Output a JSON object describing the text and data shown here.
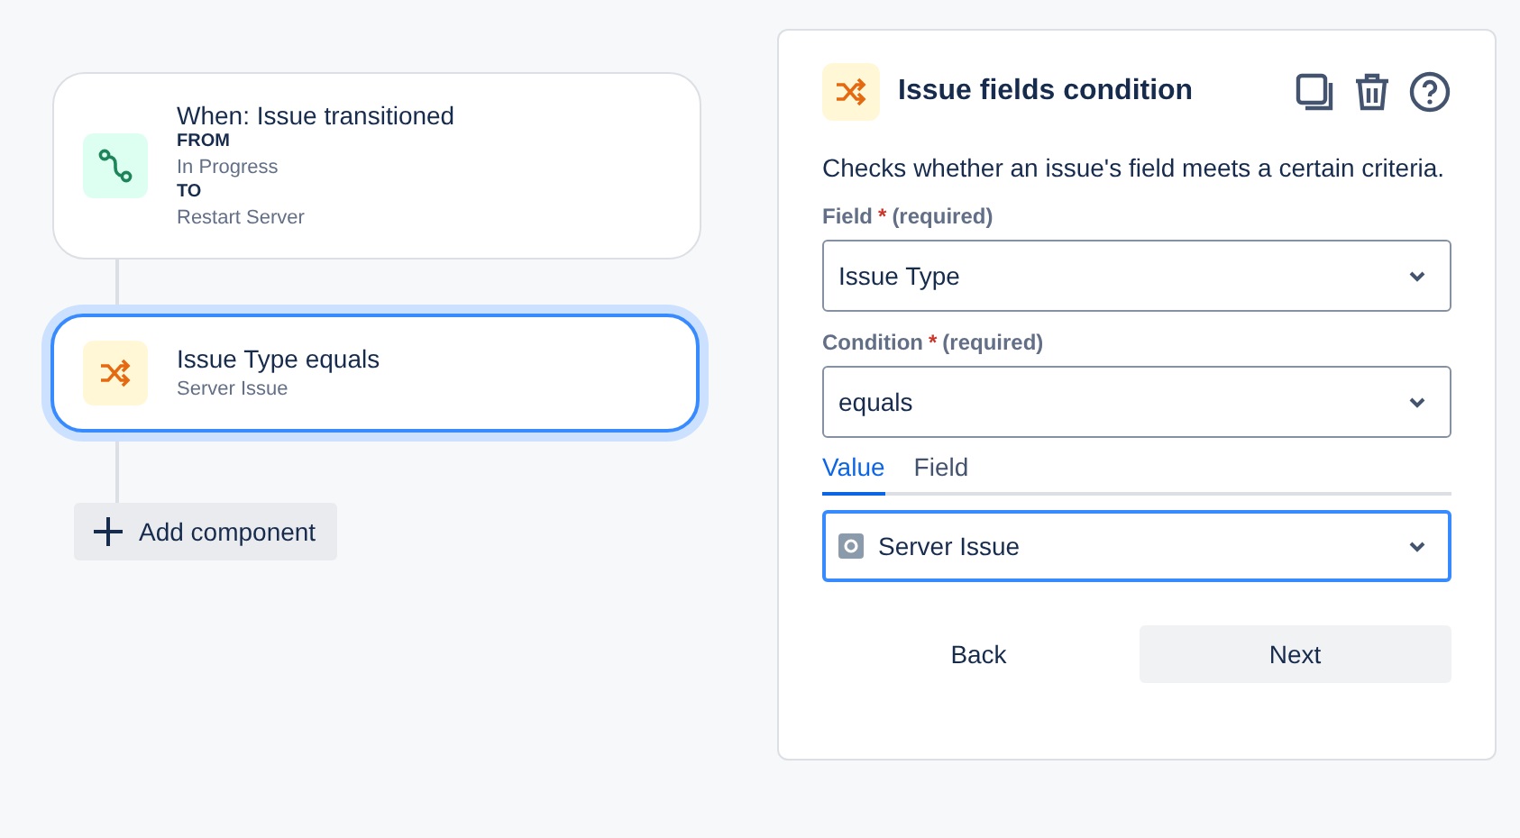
{
  "flow": {
    "nodes": [
      {
        "kind": "trigger",
        "title": "When: Issue transitioned",
        "details": [
          {
            "label": "FROM",
            "value": "In Progress"
          },
          {
            "label": "TO",
            "value": "Restart Server"
          }
        ],
        "selected": false
      },
      {
        "kind": "condition",
        "title": "Issue Type equals",
        "subtitle": "Server Issue",
        "selected": true
      }
    ],
    "add_button": "Add component"
  },
  "panel": {
    "title": "Issue fields condition",
    "description": "Checks whether an issue's field meets a certain criteria.",
    "fields": [
      {
        "label": "Field",
        "required_mark": "*",
        "hint": "(required)",
        "value": "Issue Type",
        "focused": false
      },
      {
        "label": "Condition",
        "required_mark": "*",
        "hint": "(required)",
        "value": "equals",
        "focused": false
      }
    ],
    "tabs": [
      {
        "label": "Value",
        "selected": true
      },
      {
        "label": "Field",
        "selected": false
      }
    ],
    "value_select": {
      "value": "Server Issue",
      "focused": true
    },
    "buttons": [
      {
        "label": "Back",
        "kind": "subtle"
      },
      {
        "label": "Next",
        "kind": "default"
      }
    ]
  }
}
